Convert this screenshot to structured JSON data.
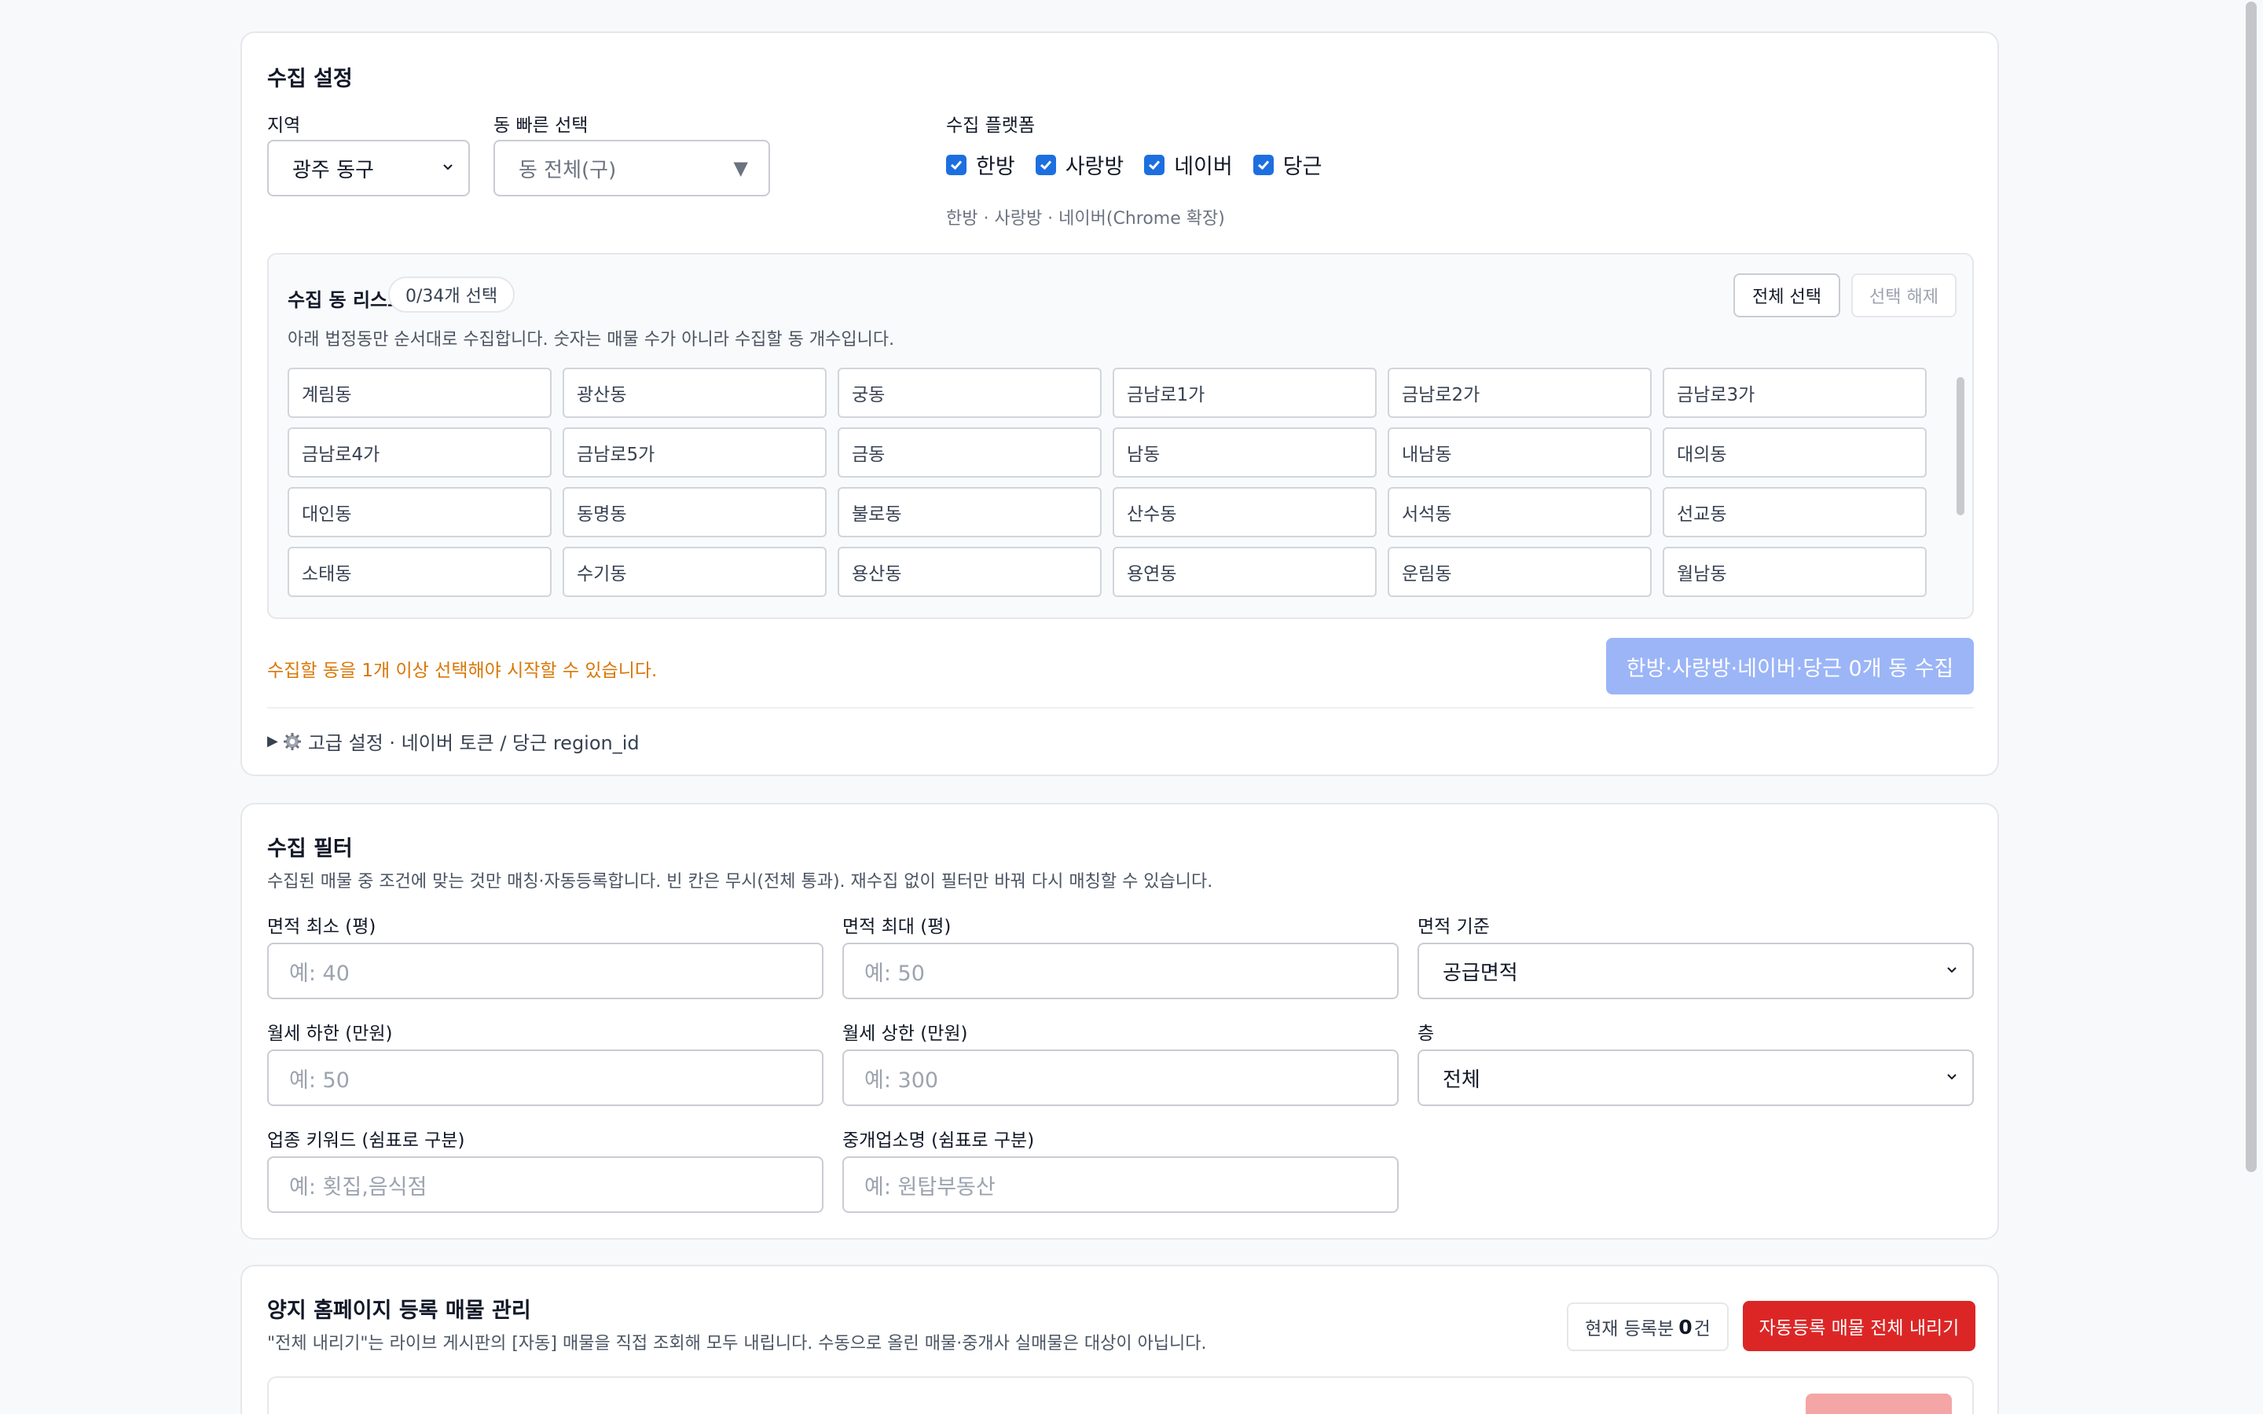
{
  "collect_settings": {
    "title": "수집 설정",
    "region_label": "지역",
    "region_value": "광주 동구",
    "quick_dong_label": "동 빠른 선택",
    "quick_dong_value": "동 전체(구)",
    "platform_label": "수집 플랫폼",
    "platforms": [
      {
        "label": "한방",
        "checked": true
      },
      {
        "label": "사랑방",
        "checked": true
      },
      {
        "label": "네이버",
        "checked": true
      },
      {
        "label": "당근",
        "checked": true
      }
    ],
    "platform_hint": "한방 · 사랑방 · 네이버(Chrome 확장)",
    "dong_list": {
      "title": "수집 동 리스트",
      "count": "0/34개 선택",
      "select_all": "전체 선택",
      "deselect": "선택 해제",
      "description": "아래 법정동만 순서대로 수집합니다. 숫자는 매물 수가 아니라 수집할 동 개수입니다.",
      "items": [
        "계림동",
        "광산동",
        "궁동",
        "금남로1가",
        "금남로2가",
        "금남로3가",
        "금남로4가",
        "금남로5가",
        "금동",
        "남동",
        "내남동",
        "대의동",
        "대인동",
        "동명동",
        "불로동",
        "산수동",
        "서석동",
        "선교동",
        "소태동",
        "수기동",
        "용산동",
        "용연동",
        "운림동",
        "월남동"
      ]
    },
    "warning": "수집할 동을 1개 이상 선택해야 시작할 수 있습니다.",
    "start_button": "한방·사랑방·네이버·당근 0개 동 수집",
    "advanced": "고급 설정 · 네이버 토큰 / 당근 region_id"
  },
  "collect_filter": {
    "title": "수집 필터",
    "description": "수집된 매물 중 조건에 맞는 것만 매칭·자동등록합니다. 빈 칸은 무시(전체 통과). 재수집 없이 필터만 바꿔 다시 매칭할 수 있습니다.",
    "area_min_label": "면적 최소 (평)",
    "area_min_placeholder": "예: 40",
    "area_max_label": "면적 최대 (평)",
    "area_max_placeholder": "예: 50",
    "area_basis_label": "면적 기준",
    "area_basis_value": "공급면적",
    "rent_min_label": "월세 하한 (만원)",
    "rent_min_placeholder": "예: 50",
    "rent_max_label": "월세 상한 (만원)",
    "rent_max_placeholder": "예: 300",
    "floor_label": "층",
    "floor_value": "전체",
    "business_label": "업종 키워드 (쉼표로 구분)",
    "business_placeholder": "예: 횟집,음식점",
    "agency_label": "중개업소명 (쉼표로 구분)",
    "agency_placeholder": "예: 원탑부동산"
  },
  "homepage_mgmt": {
    "title": "양지 홈페이지 등록 매물 관리",
    "description": "\"전체 내리기\"는 라이브 게시판의 [자동] 매물을 직접 조회해 모두 내립니다. 수동으로 올린 매물·중개사 실매물은 대상이 아닙니다.",
    "count_prefix": "현재 등록분",
    "count_value": "0",
    "count_suffix": "건",
    "remove_all_button": "자동등록 매물 전체 내리기"
  },
  "colors": {
    "accent": "#1d6fe0",
    "danger": "#dc2626",
    "warning": "#d97706",
    "disabled_primary": "#9bb5f7"
  }
}
